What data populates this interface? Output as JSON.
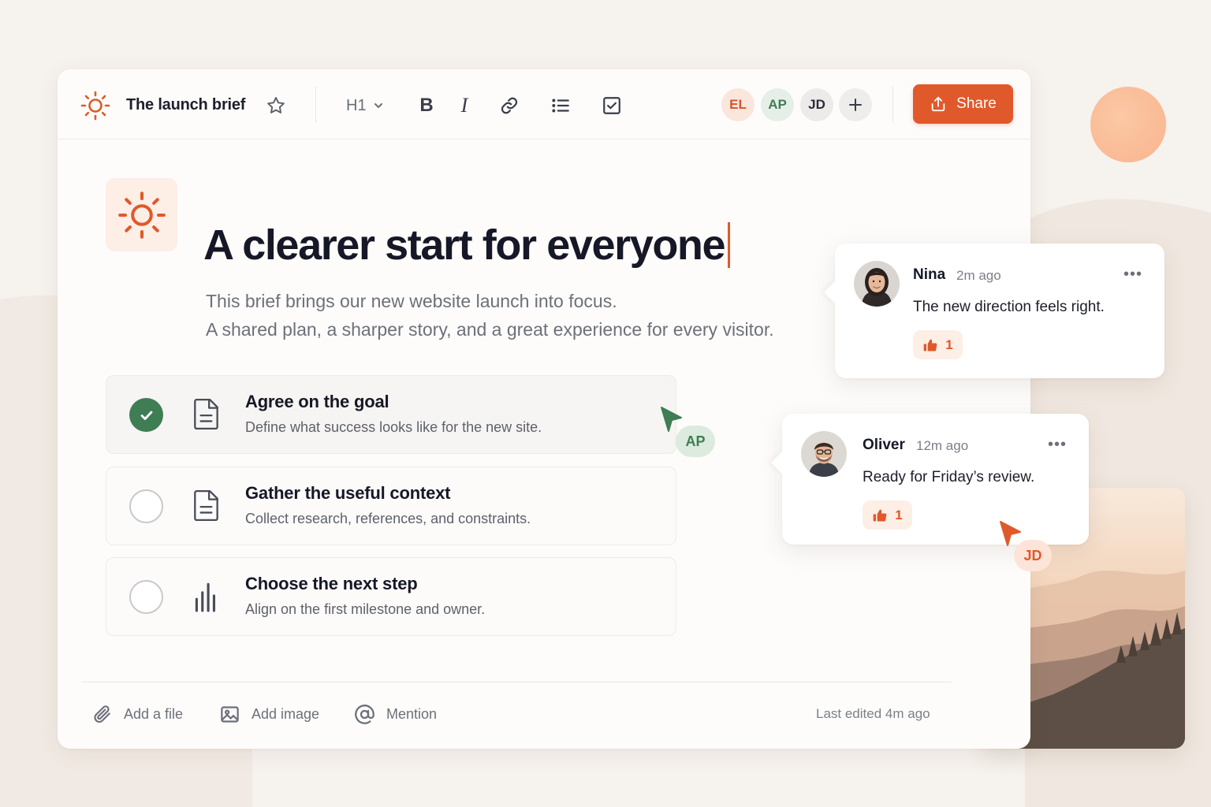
{
  "document": {
    "title": "The launch brief",
    "heading": "A clearer start for everyone",
    "subtitle_lines": [
      "This brief brings our new website launch into focus.",
      "A shared plan, a sharper story, and a great experience for every visitor."
    ]
  },
  "toolbar": {
    "heading_level": "H1",
    "share_label": "Share",
    "icons": [
      "sun-icon",
      "star-icon",
      "chevron-down-icon",
      "bold-icon",
      "italic-icon",
      "link-icon",
      "list-icon",
      "checkbox-icon",
      "plus-icon",
      "share-icon"
    ]
  },
  "collaborators": [
    {
      "initials": "EL",
      "bg": "#fbe6dc",
      "fg": "#d4562a"
    },
    {
      "initials": "AP",
      "bg": "#e6efe7",
      "fg": "#3f7d55"
    },
    {
      "initials": "JD",
      "bg": "#ecebe9",
      "fg": "#2b2d38"
    }
  ],
  "tasks": [
    {
      "title": "Agree on the goal",
      "desc": "Define what success looks like for the new site.",
      "done": true,
      "icon": "document-icon"
    },
    {
      "title": "Gather the useful context",
      "desc": "Collect research, references, and constraints.",
      "done": false,
      "icon": "document-icon"
    },
    {
      "title": "Choose the next step",
      "desc": "Align on the first milestone and owner.",
      "done": false,
      "icon": "bar-chart-icon"
    }
  ],
  "footer": {
    "add_file": "Add a file",
    "add_image": "Add image",
    "mention": "Mention",
    "last_edited": "Last edited 4m ago"
  },
  "comments": [
    {
      "name": "Nina",
      "time": "2m ago",
      "text": "The new direction feels right.",
      "likes": "1"
    },
    {
      "name": "Oliver",
      "time": "12m ago",
      "text": "Ready for Friday’s review.",
      "likes": "1"
    }
  ],
  "cursors": [
    {
      "initials": "AP",
      "color": "#3f7d55",
      "bg": "#dcebdd"
    },
    {
      "initials": "JD",
      "color": "#e0592a",
      "bg": "#fde4d8"
    }
  ],
  "colors": {
    "accent": "#e0592a",
    "success": "#3f7d55",
    "background": "#f6f2ee"
  }
}
